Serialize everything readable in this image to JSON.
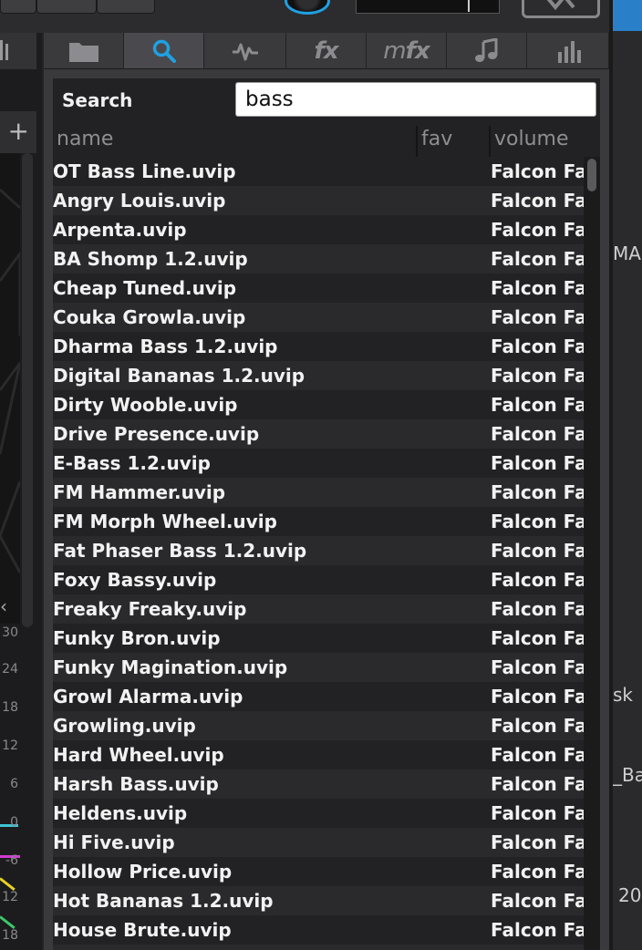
{
  "search": {
    "label": "Search",
    "value": "bass"
  },
  "tabs": [
    {
      "name": "folder-icon",
      "active": false
    },
    {
      "name": "search-icon",
      "active": true
    },
    {
      "name": "waveform-icon",
      "active": false
    },
    {
      "name": "fx",
      "label": "fx",
      "active": false
    },
    {
      "name": "mfx",
      "label_m": "m",
      "label_fx": "fx",
      "active": false
    },
    {
      "name": "music-note-icon",
      "active": false
    },
    {
      "name": "bar-chart-icon",
      "active": false
    }
  ],
  "columns": {
    "name": "name",
    "fav": "fav",
    "volume": "volume"
  },
  "rows": [
    {
      "name": "OT Bass Line.uvip",
      "volume": "Falcon Factory"
    },
    {
      "name": "Angry Louis.uvip",
      "volume": "Falcon Factory"
    },
    {
      "name": "Arpenta.uvip",
      "volume": "Falcon Factory"
    },
    {
      "name": "BA Shomp 1.2.uvip",
      "volume": "Falcon Factory"
    },
    {
      "name": "Cheap Tuned.uvip",
      "volume": "Falcon Factory"
    },
    {
      "name": "Couka Growla.uvip",
      "volume": "Falcon Factory"
    },
    {
      "name": "Dharma Bass 1.2.uvip",
      "volume": "Falcon Factory"
    },
    {
      "name": "Digital Bananas 1.2.uvip",
      "volume": "Falcon Factory"
    },
    {
      "name": "Dirty Wooble.uvip",
      "volume": "Falcon Factory"
    },
    {
      "name": "Drive Presence.uvip",
      "volume": "Falcon Factory"
    },
    {
      "name": "E-Bass 1.2.uvip",
      "volume": "Falcon Factory"
    },
    {
      "name": "FM Hammer.uvip",
      "volume": "Falcon Factory"
    },
    {
      "name": "FM Morph Wheel.uvip",
      "volume": "Falcon Factory"
    },
    {
      "name": "Fat Phaser Bass 1.2.uvip",
      "volume": "Falcon Factory"
    },
    {
      "name": "Foxy Bassy.uvip",
      "volume": "Falcon Factory"
    },
    {
      "name": "Freaky Freaky.uvip",
      "volume": "Falcon Factory"
    },
    {
      "name": "Funky Bron.uvip",
      "volume": "Falcon Factory"
    },
    {
      "name": "Funky Magination.uvip",
      "volume": "Falcon Factory"
    },
    {
      "name": "Growl Alarma.uvip",
      "volume": "Falcon Factory"
    },
    {
      "name": "Growling.uvip",
      "volume": "Falcon Factory"
    },
    {
      "name": "Hard Wheel.uvip",
      "volume": "Falcon Factory"
    },
    {
      "name": "Harsh Bass.uvip",
      "volume": "Falcon Factory"
    },
    {
      "name": "Heldens.uvip",
      "volume": "Falcon Factory"
    },
    {
      "name": "Hi Five.uvip",
      "volume": "Falcon Factory"
    },
    {
      "name": "Hollow Price.uvip",
      "volume": "Falcon Factory"
    },
    {
      "name": "Hot Bananas 1.2.uvip",
      "volume": "Falcon Factory"
    },
    {
      "name": "House Brute.uvip",
      "volume": "Falcon Factory"
    },
    {
      "name": "",
      "volume": ""
    }
  ],
  "left_meter": [
    "30",
    "24",
    "18",
    "12",
    "6",
    "0",
    "-6",
    "12",
    "18"
  ],
  "right_fragments": [
    "MAIS",
    "sk",
    "_Ba",
    "20"
  ],
  "colors": {
    "accent": "#1fa1e3",
    "panel": "#3a3a3d",
    "list_bg": "#222224",
    "search_bg": "#ffffff"
  }
}
